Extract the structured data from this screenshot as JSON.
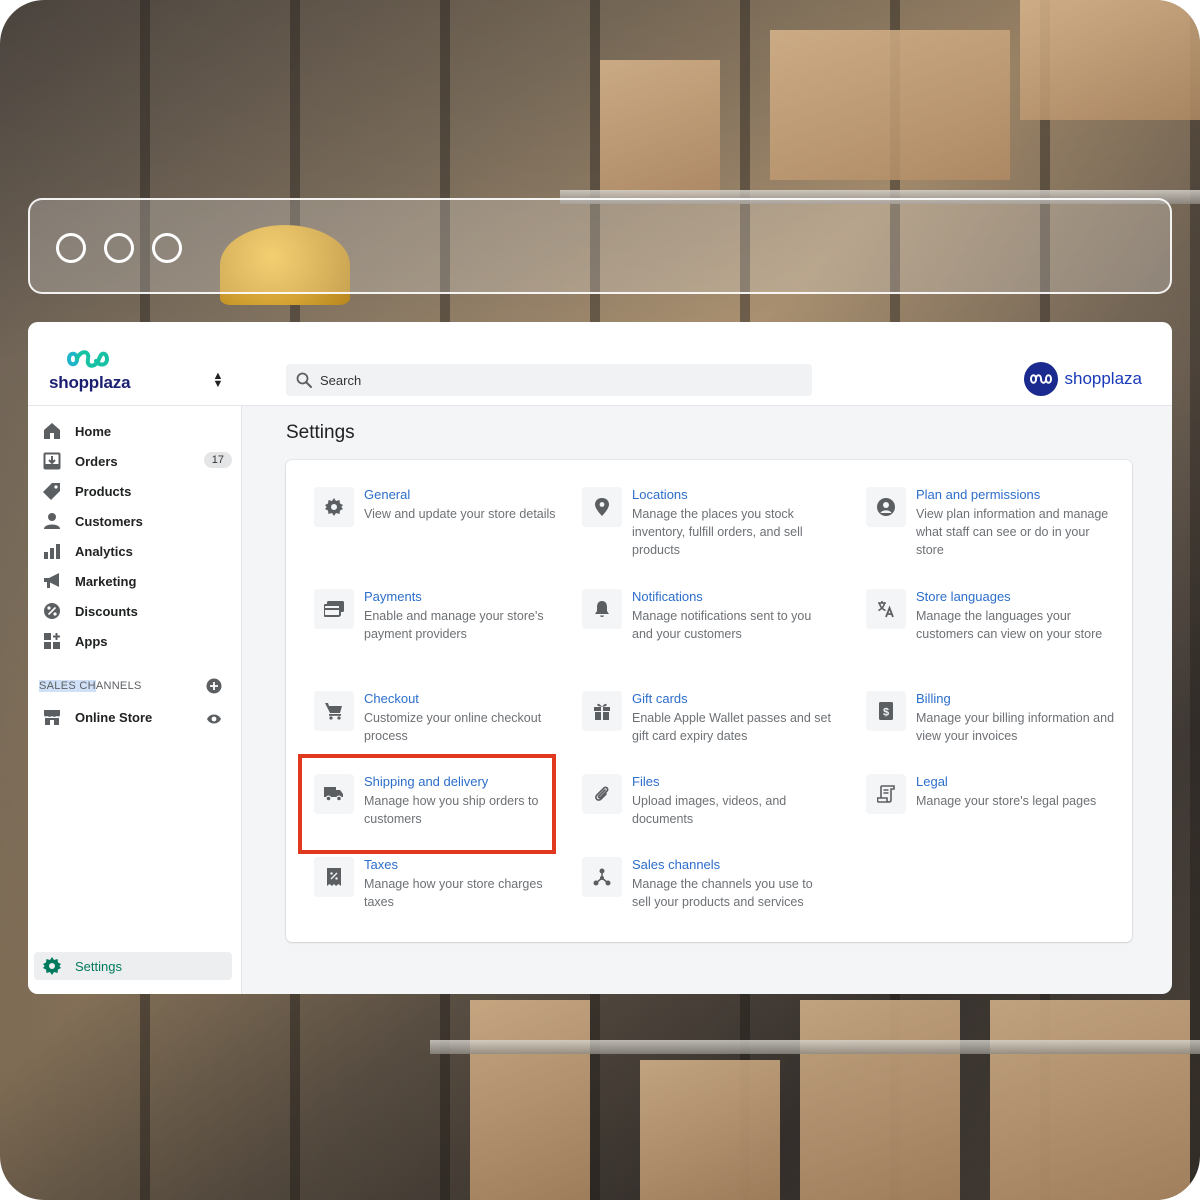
{
  "app": {
    "logo_text": "shopplaza",
    "brand_text": "shopplaza"
  },
  "search": {
    "placeholder": "Search"
  },
  "sidebar": {
    "items": [
      {
        "label": "Home",
        "icon": "home-icon"
      },
      {
        "label": "Orders",
        "icon": "orders-icon",
        "badge": "17"
      },
      {
        "label": "Products",
        "icon": "tag-icon"
      },
      {
        "label": "Customers",
        "icon": "person-icon"
      },
      {
        "label": "Analytics",
        "icon": "bar-chart-icon"
      },
      {
        "label": "Marketing",
        "icon": "megaphone-icon"
      },
      {
        "label": "Discounts",
        "icon": "discount-icon"
      },
      {
        "label": "Apps",
        "icon": "apps-icon"
      }
    ],
    "sales_channels_label_highlight": "SALES CH",
    "sales_channels_label_rest": "ANNELS",
    "channels": [
      {
        "label": "Online Store",
        "icon": "store-icon"
      }
    ],
    "settings_label": "Settings"
  },
  "page": {
    "title": "Settings"
  },
  "settings": [
    {
      "title": "General",
      "desc": "View and update your store details",
      "icon": "gear-icon"
    },
    {
      "title": "Locations",
      "desc": "Manage the places you stock inventory, fulfill orders, and sell products",
      "icon": "location-pin-icon"
    },
    {
      "title": "Plan and permissions",
      "desc": "View plan information and manage what staff can see or do in your store",
      "icon": "user-circle-icon"
    },
    {
      "title": "Payments",
      "desc": "Enable and manage your store's payment providers",
      "icon": "credit-card-icon"
    },
    {
      "title": "Notifications",
      "desc": "Manage notifications sent to you and your customers",
      "icon": "bell-icon"
    },
    {
      "title": "Store languages",
      "desc": "Manage the languages your customers can view on your store",
      "icon": "translate-icon"
    },
    {
      "title": "Checkout",
      "desc": "Customize your online checkout process",
      "icon": "cart-icon"
    },
    {
      "title": "Gift cards",
      "desc": "Enable Apple Wallet passes and set gift card expiry dates",
      "icon": "gift-icon"
    },
    {
      "title": "Billing",
      "desc": "Manage your billing information and view your invoices",
      "icon": "billing-icon"
    },
    {
      "title": "Shipping and delivery",
      "desc": "Manage how you ship orders to customers",
      "icon": "truck-icon"
    },
    {
      "title": "Files",
      "desc": "Upload images, videos, and documents",
      "icon": "paperclip-icon"
    },
    {
      "title": "Legal",
      "desc": "Manage your store's legal pages",
      "icon": "legal-icon"
    },
    {
      "title": "Taxes",
      "desc": "Manage how your store charges taxes",
      "icon": "tax-receipt-icon"
    },
    {
      "title": "Sales channels",
      "desc": "Manage the channels you use to sell your products and services",
      "icon": "channels-icon"
    }
  ],
  "colors": {
    "accent_link": "#2c6ecb",
    "highlight_box": "#e0391f",
    "active_nav": "#007a5c",
    "brand_navy": "#1a1f71"
  }
}
